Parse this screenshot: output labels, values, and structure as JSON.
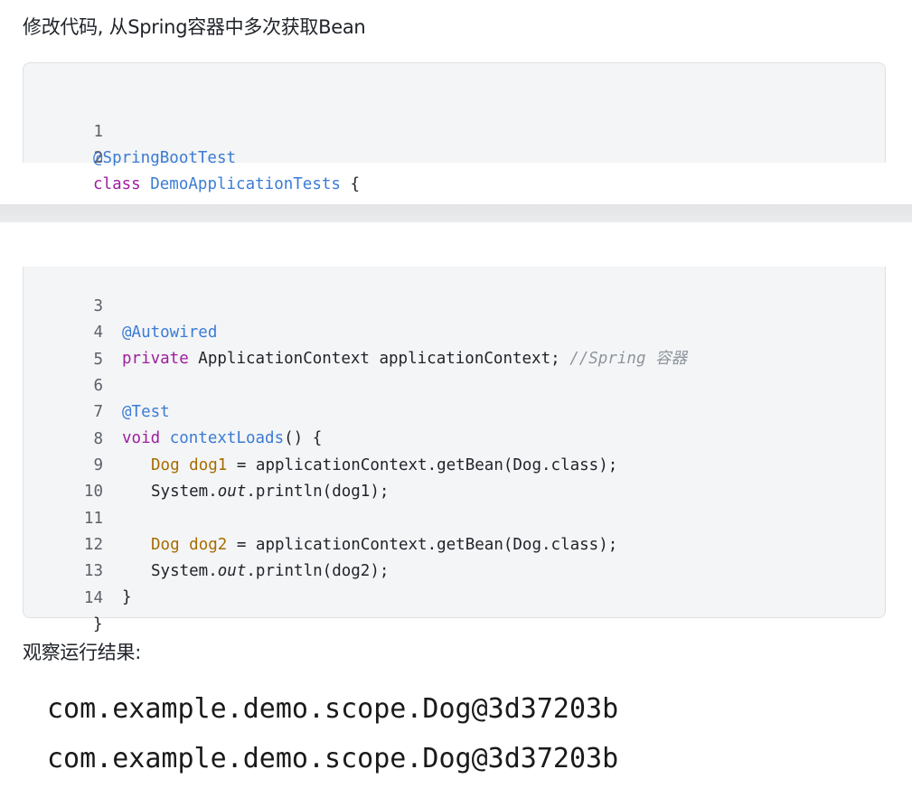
{
  "heading": "修改代码, 从Spring容器中多次获取Bean",
  "code": {
    "lines": [
      {
        "n": "1",
        "tokens": [
          {
            "t": "@SpringBootTest",
            "k": "annot"
          }
        ]
      },
      {
        "n": "2",
        "tokens": [
          {
            "t": "class",
            "k": "kw"
          },
          {
            "t": " ",
            "k": "plain"
          },
          {
            "t": "DemoApplicationTests",
            "k": "cls"
          },
          {
            "t": " {",
            "k": "plain"
          }
        ]
      },
      {
        "n": "3",
        "tokens": [
          {
            "t": "@Autowired",
            "k": "annot"
          }
        ]
      },
      {
        "n": "4",
        "tokens": [
          {
            "t": "private",
            "k": "kw"
          },
          {
            "t": " ApplicationContext applicationContext; ",
            "k": "plain"
          },
          {
            "t": "//Spring 容器",
            "k": "comment"
          }
        ]
      },
      {
        "n": "5",
        "tokens": []
      },
      {
        "n": "6",
        "tokens": [
          {
            "t": "@Test",
            "k": "annot"
          }
        ]
      },
      {
        "n": "7",
        "tokens": [
          {
            "t": "void",
            "k": "kw"
          },
          {
            "t": " ",
            "k": "plain"
          },
          {
            "t": "contextLoads",
            "k": "fn"
          },
          {
            "t": "() {",
            "k": "plain"
          }
        ]
      },
      {
        "n": "8",
        "tokens": [
          {
            "t": "Dog",
            "k": "type"
          },
          {
            "t": " ",
            "k": "plain"
          },
          {
            "t": "dog1",
            "k": "var"
          },
          {
            "t": " = applicationContext.getBean(Dog.class);",
            "k": "plain"
          }
        ]
      },
      {
        "n": "9",
        "tokens": [
          {
            "t": "System.",
            "k": "plain"
          },
          {
            "t": "out",
            "k": "it"
          },
          {
            "t": ".println(dog1);",
            "k": "plain"
          }
        ]
      },
      {
        "n": "10",
        "tokens": []
      },
      {
        "n": "11",
        "tokens": [
          {
            "t": "Dog",
            "k": "type"
          },
          {
            "t": " ",
            "k": "plain"
          },
          {
            "t": "dog2",
            "k": "var"
          },
          {
            "t": " = applicationContext.getBean(Dog.class);",
            "k": "plain"
          }
        ]
      },
      {
        "n": "12",
        "tokens": [
          {
            "t": "System.",
            "k": "plain"
          },
          {
            "t": "out",
            "k": "it"
          },
          {
            "t": ".println(dog2);",
            "k": "plain"
          }
        ]
      },
      {
        "n": "13",
        "tokens": [
          {
            "t": "}",
            "k": "plain"
          }
        ]
      },
      {
        "n": "14",
        "tokens": [
          {
            "t": "}",
            "k": "plain"
          }
        ]
      }
    ]
  },
  "subheading": "观察运行结果:",
  "output": [
    "com.example.demo.scope.Dog@3d37203b",
    "com.example.demo.scope.Dog@3d37203b"
  ]
}
